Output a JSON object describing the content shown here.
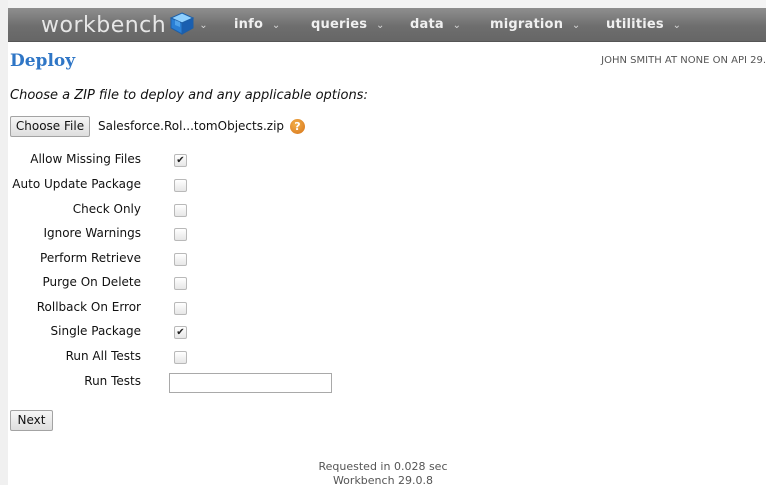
{
  "nav": {
    "brand": "workbench",
    "menu": [
      {
        "label": "info"
      },
      {
        "label": "queries"
      },
      {
        "label": "data"
      },
      {
        "label": "migration"
      },
      {
        "label": "utilities"
      }
    ],
    "caret": "⌄"
  },
  "page": {
    "title": "Deploy",
    "user_info": "JOHN SMITH AT NONE ON API 29.",
    "instructions": "Choose a ZIP file to deploy and any applicable options:"
  },
  "file": {
    "button_label": "Choose File",
    "filename": "Salesforce.Rol...tomObjects.zip",
    "help_icon": "question-icon",
    "help_glyph": "?"
  },
  "options": [
    {
      "label": "Allow Missing Files",
      "checked": true
    },
    {
      "label": "Auto Update Package",
      "checked": false
    },
    {
      "label": "Check Only",
      "checked": false
    },
    {
      "label": "Ignore Warnings",
      "checked": false
    },
    {
      "label": "Perform Retrieve",
      "checked": false
    },
    {
      "label": "Purge On Delete",
      "checked": false
    },
    {
      "label": "Rollback On Error",
      "checked": false
    },
    {
      "label": "Single Package",
      "checked": true
    },
    {
      "label": "Run All Tests",
      "checked": false
    }
  ],
  "run_tests": {
    "label": "Run Tests",
    "value": ""
  },
  "next_label": "Next",
  "footer": {
    "requested": "Requested in 0.028 sec",
    "version": "Workbench 29.0.8"
  },
  "colors": {
    "title": "#2f76c6",
    "navbar": "#7a7a7a"
  }
}
